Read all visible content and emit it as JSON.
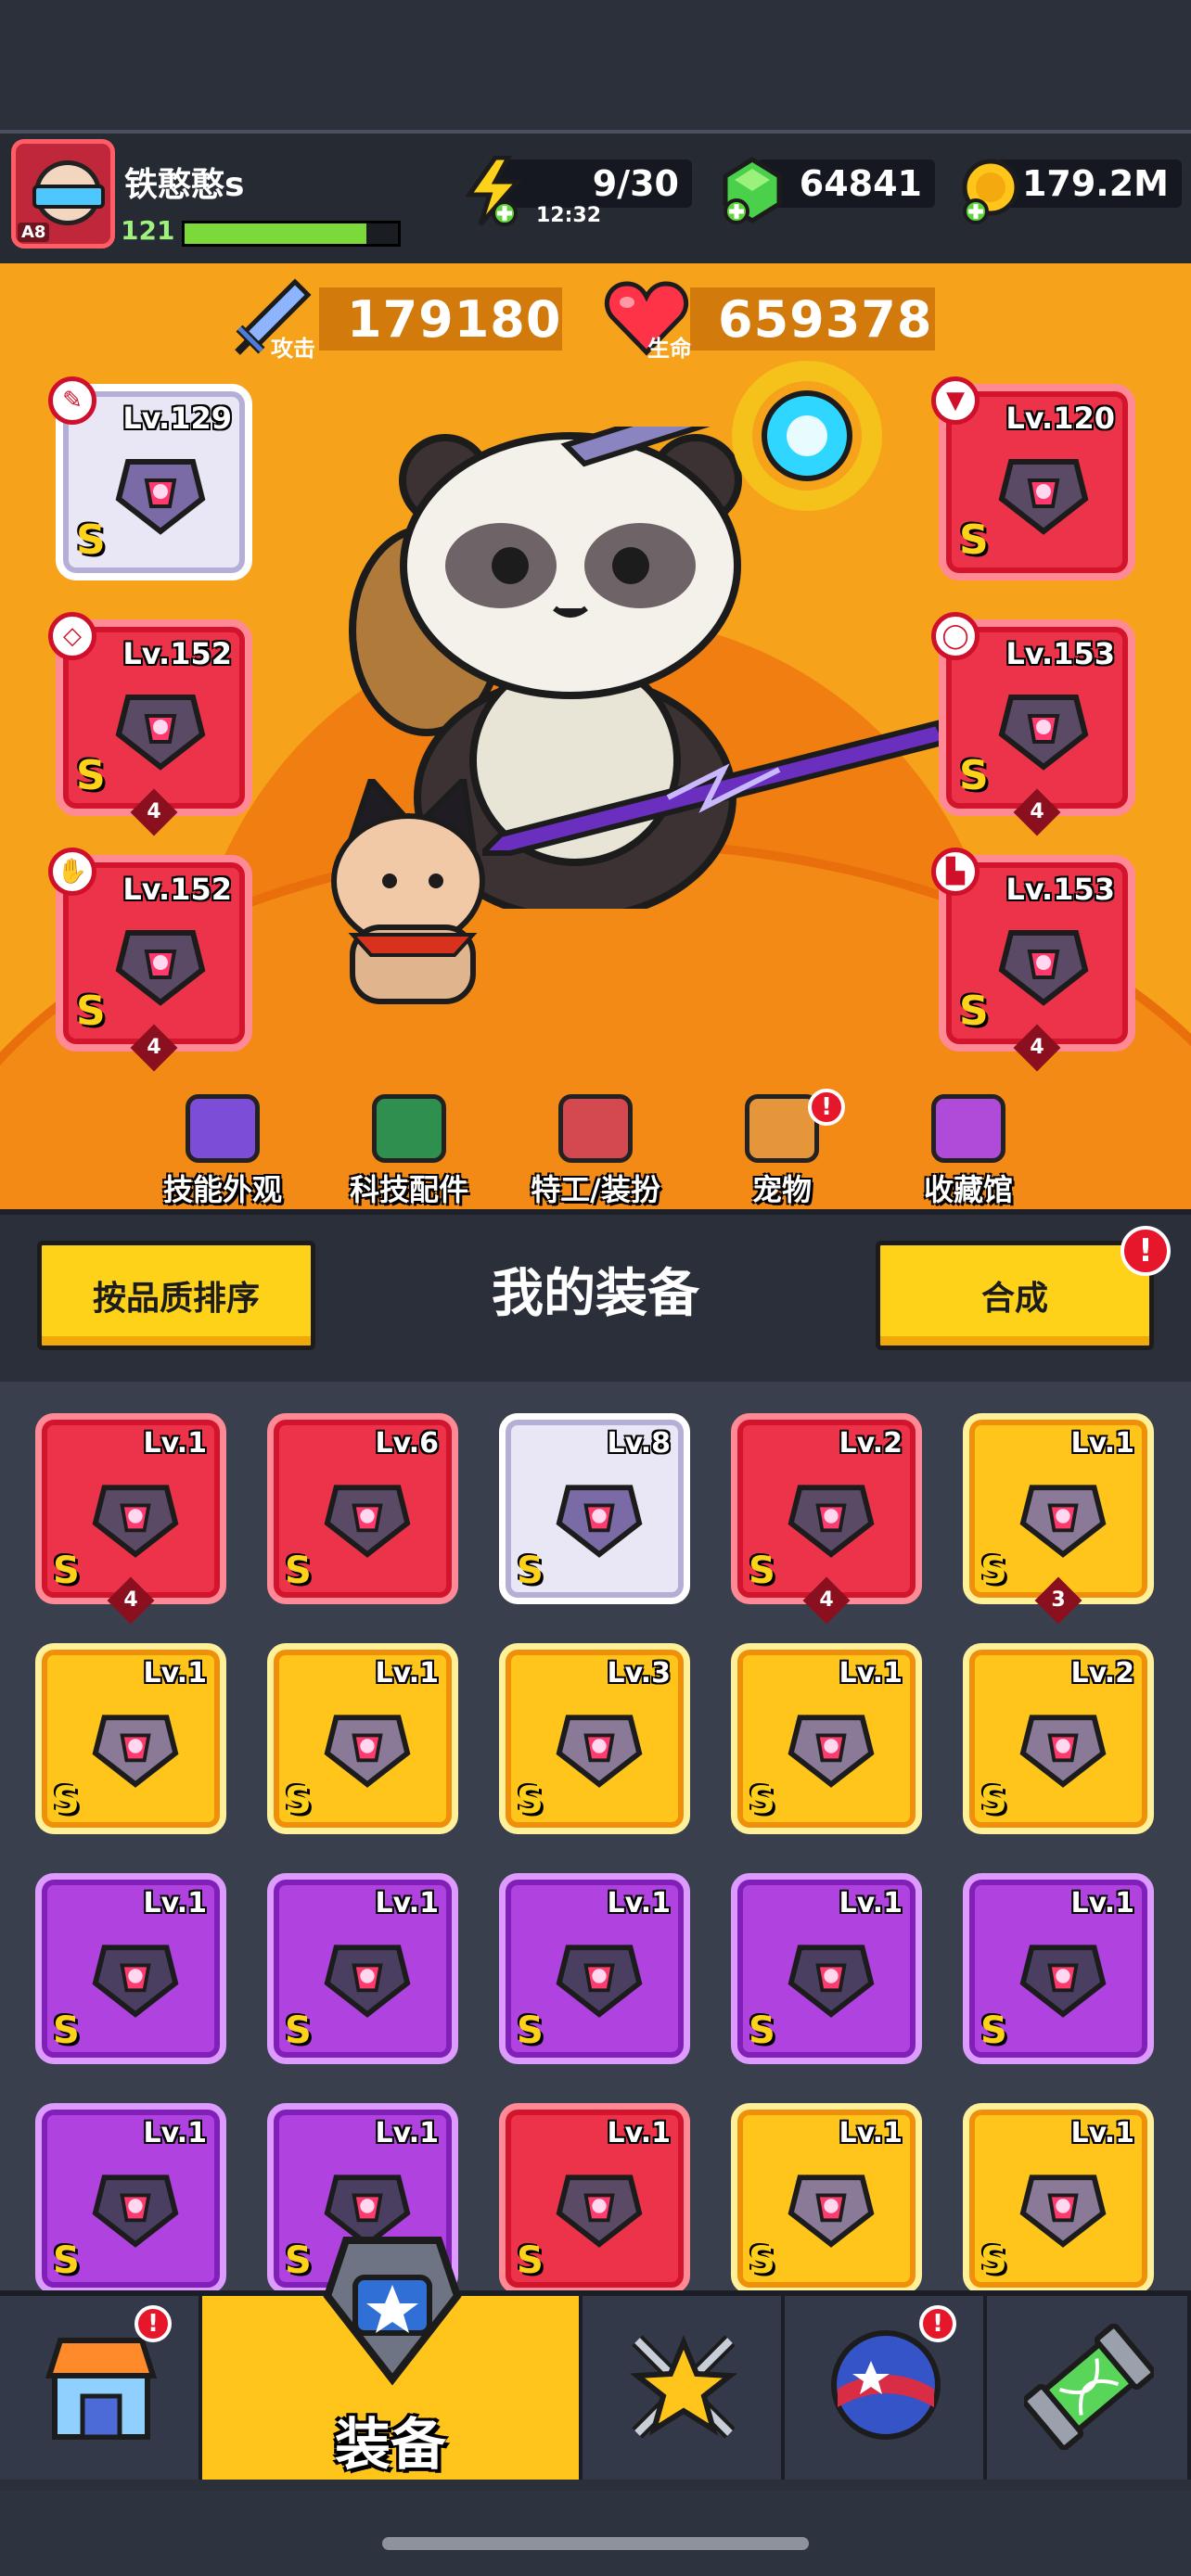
{
  "player": {
    "name": "铁憨憨s",
    "rank": "A8",
    "level": "121",
    "xp_fraction": 0.85
  },
  "energy": {
    "value": "9/30",
    "timer": "12:32"
  },
  "gems": "64841",
  "coins": "179.2M",
  "stats": {
    "attack_label": "攻击",
    "attack": "179180",
    "hp_label": "生命",
    "hp": "659378"
  },
  "equipped": {
    "left": [
      {
        "level": "Lv.129",
        "grade": "S",
        "quality": "silver",
        "badge": "✎",
        "stars": ""
      },
      {
        "level": "Lv.152",
        "grade": "S",
        "quality": "red",
        "badge": "◇",
        "stars": "4"
      },
      {
        "level": "Lv.152",
        "grade": "S",
        "quality": "red",
        "badge": "✋",
        "stars": "4"
      }
    ],
    "right": [
      {
        "level": "Lv.120",
        "grade": "S",
        "quality": "red",
        "badge": "▼",
        "stars": ""
      },
      {
        "level": "Lv.153",
        "grade": "S",
        "quality": "red",
        "badge": "◯",
        "stars": "4"
      },
      {
        "level": "Lv.153",
        "grade": "S",
        "quality": "red",
        "badge": "▙",
        "stars": "4"
      }
    ]
  },
  "category_tabs": [
    {
      "label": "技能外观",
      "icon": "skill-skin-icon",
      "color": "#7c4dd6",
      "alert": false
    },
    {
      "label": "科技配件",
      "icon": "tech-parts-icon",
      "color": "#2f8f4e",
      "alert": false
    },
    {
      "label": "特工/装扮",
      "icon": "agent-outfit-icon",
      "color": "#d4494f",
      "alert": false
    },
    {
      "label": "宠物",
      "icon": "pet-icon",
      "color": "#e5953a",
      "alert": true
    },
    {
      "label": "收藏馆",
      "icon": "collection-icon",
      "color": "#b04ad8",
      "alert": false
    }
  ],
  "panel": {
    "sort_button": "按品质排序",
    "title": "我的装备",
    "merge_button": "合成",
    "alert_mark": "!"
  },
  "inventory": [
    {
      "level": "Lv.1",
      "grade": "S",
      "quality": "red",
      "stars": "4"
    },
    {
      "level": "Lv.6",
      "grade": "S",
      "quality": "red",
      "stars": ""
    },
    {
      "level": "Lv.8",
      "grade": "S",
      "quality": "silver",
      "stars": ""
    },
    {
      "level": "Lv.2",
      "grade": "S",
      "quality": "red",
      "stars": "4"
    },
    {
      "level": "Lv.1",
      "grade": "S",
      "quality": "yellow",
      "stars": "3"
    },
    {
      "level": "Lv.1",
      "grade": "S",
      "quality": "yellow",
      "stars": ""
    },
    {
      "level": "Lv.1",
      "grade": "S",
      "quality": "yellow",
      "stars": ""
    },
    {
      "level": "Lv.3",
      "grade": "S",
      "quality": "yellow",
      "stars": ""
    },
    {
      "level": "Lv.1",
      "grade": "S",
      "quality": "yellow",
      "stars": ""
    },
    {
      "level": "Lv.2",
      "grade": "S",
      "quality": "yellow",
      "stars": ""
    },
    {
      "level": "Lv.1",
      "grade": "S",
      "quality": "purple",
      "stars": ""
    },
    {
      "level": "Lv.1",
      "grade": "S",
      "quality": "purple",
      "stars": ""
    },
    {
      "level": "Lv.1",
      "grade": "S",
      "quality": "purple",
      "stars": ""
    },
    {
      "level": "Lv.1",
      "grade": "S",
      "quality": "purple",
      "stars": ""
    },
    {
      "level": "Lv.1",
      "grade": "S",
      "quality": "purple",
      "stars": ""
    },
    {
      "level": "Lv.1",
      "grade": "S",
      "quality": "purple",
      "stars": ""
    },
    {
      "level": "Lv.1",
      "grade": "S",
      "quality": "purple",
      "stars": ""
    },
    {
      "level": "Lv.1",
      "grade": "S",
      "quality": "red",
      "stars": ""
    },
    {
      "level": "Lv.1",
      "grade": "S",
      "quality": "yellow",
      "stars": ""
    },
    {
      "level": "Lv.1",
      "grade": "S",
      "quality": "yellow",
      "stars": ""
    }
  ],
  "bottom_nav": [
    {
      "label": "",
      "icon": "shop-icon",
      "active": false,
      "alert": true
    },
    {
      "label": "装备",
      "icon": "equipment-icon",
      "active": true,
      "alert": false
    },
    {
      "label": "",
      "icon": "battle-star-icon",
      "active": false,
      "alert": false
    },
    {
      "label": "",
      "icon": "planet-icon",
      "active": false,
      "alert": true
    },
    {
      "label": "",
      "icon": "dna-capsule-icon",
      "active": false,
      "alert": false
    }
  ]
}
